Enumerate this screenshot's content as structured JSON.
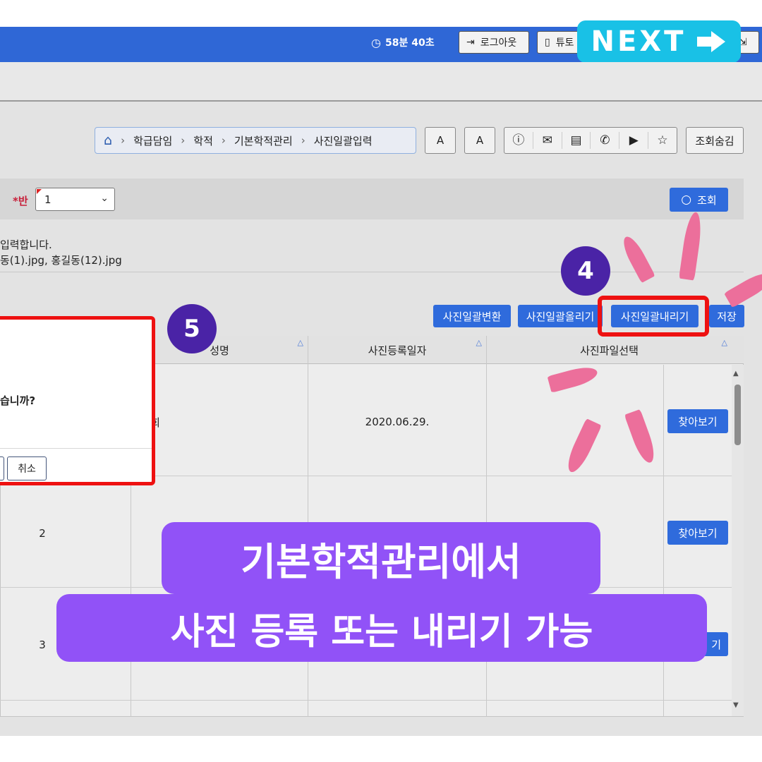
{
  "topbar": {
    "timer": "58분 40초",
    "logout_label": "로그아웃",
    "tutorial_label": "튜토",
    "next_label": "NEXT"
  },
  "breadcrumb": [
    "학급담임",
    "학적",
    "기본학적관리",
    "사진일괄입력"
  ],
  "font_buttons": [
    "A",
    "A"
  ],
  "toolbar": {
    "hide_label": "조회숨김"
  },
  "filter": {
    "ban_label": "*반",
    "ban_value": "1",
    "search_label": "조회"
  },
  "info": {
    "line1": "입력합니다.",
    "line2": "동(1).jpg, 홍길동(12).jpg"
  },
  "actions": {
    "convert": "사진일괄변환",
    "upload": "사진일괄올리기",
    "download": "사진일괄내리기",
    "save": "저장"
  },
  "table": {
    "headers": [
      "성명",
      "사진등록일자",
      "사진파일선택"
    ],
    "rows": [
      {
        "no": "",
        "name": "희",
        "date": "2020.06.29.",
        "browse": "찾아보기"
      },
      {
        "no": "2",
        "name": "",
        "date": "",
        "browse": "찾아보기"
      },
      {
        "no": "3",
        "name": "",
        "date": "",
        "browse": "기"
      }
    ]
  },
  "modal": {
    "question": "습니까?",
    "cancel_label": "취소"
  },
  "badges": {
    "step4": "4",
    "step5": "5"
  },
  "caption": {
    "line1": "기본학적관리에서",
    "line2": "사진 등록 또는 내리기 가능"
  },
  "colors": {
    "topbar": "#2f67d6",
    "primary_button": "#2f6bdc",
    "highlight": "#ee1111",
    "badge": "#4a23a6",
    "caption": "#9152f7",
    "next": "#19c1e6",
    "rays": "#ec6f9b"
  }
}
